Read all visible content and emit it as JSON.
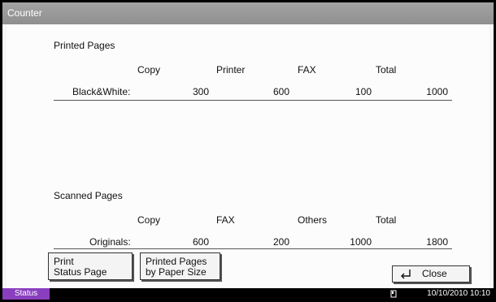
{
  "window": {
    "title": "Counter"
  },
  "printed_pages": {
    "section_title": "Printed Pages",
    "columns": [
      "Copy",
      "Printer",
      "FAX",
      "Total"
    ],
    "row_label": "Black&White:",
    "values": [
      "300",
      "600",
      "100",
      "1000"
    ]
  },
  "scanned_pages": {
    "section_title": "Scanned Pages",
    "columns": [
      "Copy",
      "FAX",
      "Others",
      "Total"
    ],
    "row_label": "Originals:",
    "values": [
      "600",
      "200",
      "1000",
      "1800"
    ]
  },
  "buttons": {
    "print_status_line1": "Print",
    "print_status_line2": "Status Page",
    "by_paper_size_line1": "Printed Pages",
    "by_paper_size_line2": "by Paper Size",
    "close_label": "Close",
    "close_icon": "return-arrow-icon"
  },
  "status_bar": {
    "status_tab_label": "Status",
    "datetime": "10/10/2010  10:10",
    "memory_icon": "memory-card-icon"
  },
  "colors": {
    "title_bar": "#999999",
    "status_tab": "#8a3fbf",
    "panel_background": "#fcfcfc"
  }
}
